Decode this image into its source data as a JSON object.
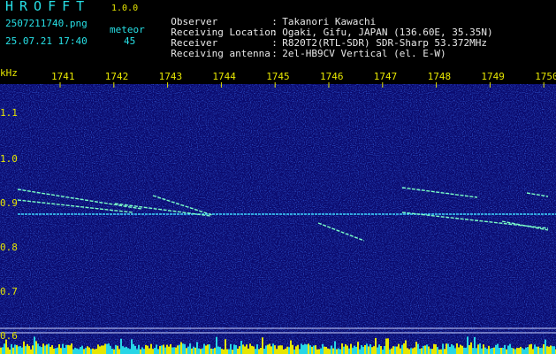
{
  "header": {
    "logo": "HROFFT",
    "version": "1.0.0",
    "filename": "2507211740.png",
    "datetime": "25.07.21 17:40",
    "meteor_label": "meteor",
    "meteor_count": "45"
  },
  "info": [
    {
      "key": "Observer",
      "value": "Takanori Kawachi"
    },
    {
      "key": "Receiving Location",
      "value": "Ogaki, Gifu, JAPAN (136.60E, 35.35N)"
    },
    {
      "key": "Receiver",
      "value": "R820T2(RTL-SDR) SDR-Sharp 53.372MHz"
    },
    {
      "key": "Receiving antenna",
      "value": "2el-HB9CV Vertical (el. E-W)"
    }
  ],
  "axis": {
    "unit": "kHz",
    "time_ticks": [
      "1741",
      "1742",
      "1743",
      "1744",
      "1745",
      "1746",
      "1747",
      "1748",
      "1749",
      "1750"
    ],
    "freq_ticks": [
      "1.1",
      "1.0",
      "0.9",
      "0.8",
      "0.7",
      "0.6"
    ]
  },
  "colors": {
    "background": "#0a0a6e",
    "carrier": "#3ed8ff",
    "trail": "#7affc8",
    "text_cyan": "#27e0e6",
    "text_yellow": "#e6e600",
    "histogram": "#e6e600"
  }
}
